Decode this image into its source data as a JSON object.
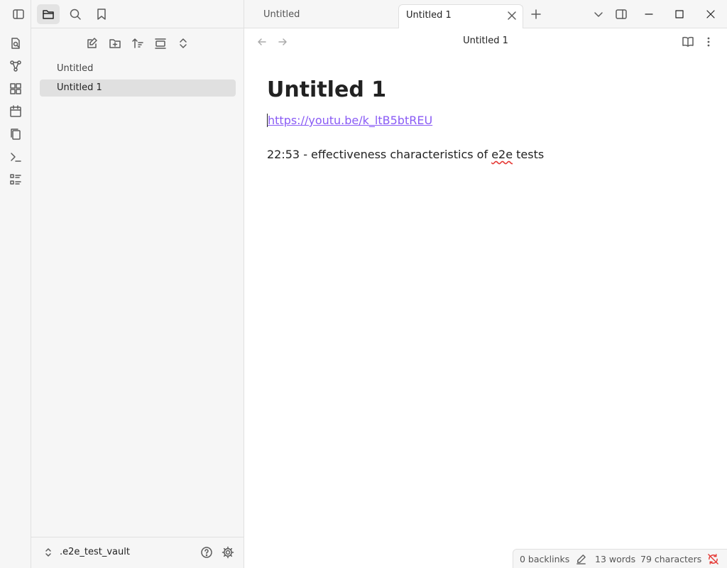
{
  "ribbon": {
    "icons": [
      "open-quick-switcher-icon",
      "graph-view-icon",
      "canvas-icon",
      "daily-note-icon",
      "templates-icon",
      "command-palette-icon",
      "slides-icon"
    ]
  },
  "sidebar": {
    "top_icons": [
      "toggle-sidebar-icon",
      "files-icon",
      "search-icon",
      "bookmark-icon"
    ],
    "nav_icons": [
      "new-note-icon",
      "new-folder-icon",
      "sort-icon",
      "collapse-icon",
      "expand-icon"
    ],
    "files": [
      {
        "label": "Untitled"
      },
      {
        "label": "Untitled 1"
      }
    ],
    "vault_name": ".e2e_test_vault"
  },
  "tabs": [
    {
      "label": "Untitled"
    },
    {
      "label": "Untitled 1"
    }
  ],
  "header": {
    "title": "Untitled 1"
  },
  "note": {
    "title": "Untitled 1",
    "link": "https://youtu.be/k_ltB5btREU",
    "line_before": "22:53 - effectiveness characteristics of ",
    "misspelled_word": "e2e",
    "line_after": " tests"
  },
  "status": {
    "backlinks": "0 backlinks",
    "words": "13 words",
    "characters": "79 characters"
  },
  "colors": {
    "accent": "#8a5cf5",
    "error": "#e53935",
    "background_secondary": "#f6f6f6"
  }
}
